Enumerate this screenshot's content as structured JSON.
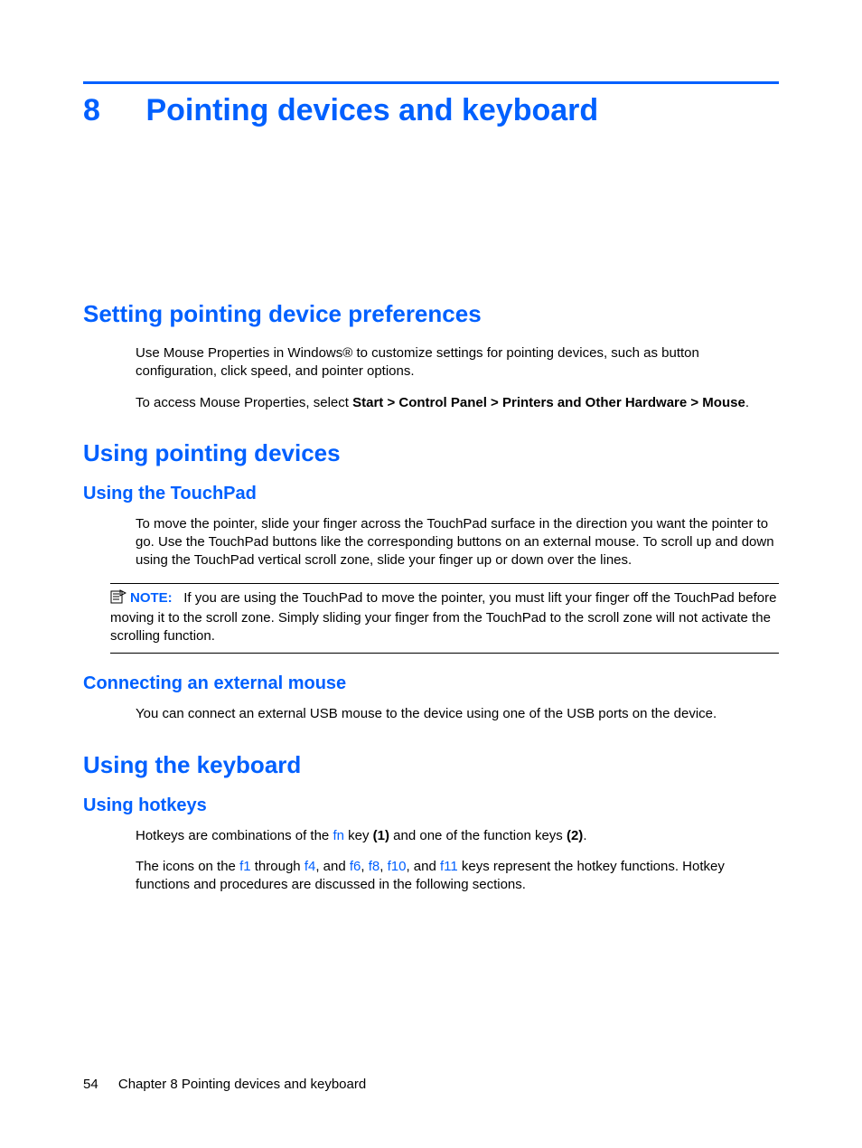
{
  "chapter": {
    "number": "8",
    "title": "Pointing devices and keyboard"
  },
  "sections": {
    "prefs": {
      "heading": "Setting pointing device preferences",
      "p1": "Use Mouse Properties in Windows® to customize settings for pointing devices, such as button configuration, click speed, and pointer options.",
      "p2a": "To access Mouse Properties, select ",
      "p2b": "Start > Control Panel > Printers and Other Hardware > Mouse",
      "p2c": "."
    },
    "using_devices": {
      "heading": "Using pointing devices",
      "touchpad": {
        "heading": "Using the TouchPad",
        "p1": "To move the pointer, slide your finger across the TouchPad surface in the direction you want the pointer to go. Use the TouchPad buttons like the corresponding buttons on an external mouse. To scroll up and down using the TouchPad vertical scroll zone, slide your finger up or down over the lines.",
        "note_label": "NOTE:",
        "note_text": "If you are using the TouchPad to move the pointer, you must lift your finger off the TouchPad before moving it to the scroll zone. Simply sliding your finger from the TouchPad to the scroll zone will not activate the scrolling function."
      },
      "external_mouse": {
        "heading": "Connecting an external mouse",
        "p1": "You can connect an external USB mouse to the device using one of the USB ports on the device."
      }
    },
    "keyboard": {
      "heading": "Using the keyboard",
      "hotkeys": {
        "heading": "Using hotkeys",
        "p1_a": "Hotkeys are combinations of the ",
        "p1_fn": "fn",
        "p1_b": " key ",
        "p1_one": "(1)",
        "p1_c": " and one of the function keys ",
        "p1_two": "(2)",
        "p1_d": ".",
        "p2_a": "The icons on the ",
        "p2_f1": "f1",
        "p2_b": " through ",
        "p2_f4": "f4",
        "p2_c": ", and ",
        "p2_f6": "f6",
        "p2_d": ", ",
        "p2_f8": "f8",
        "p2_e": ", ",
        "p2_f10": "f10",
        "p2_f": ", and ",
        "p2_f11": "f11",
        "p2_g": " keys represent the hotkey functions. Hotkey functions and procedures are discussed in the following sections."
      }
    }
  },
  "footer": {
    "page": "54",
    "label": "Chapter 8   Pointing devices and keyboard"
  }
}
